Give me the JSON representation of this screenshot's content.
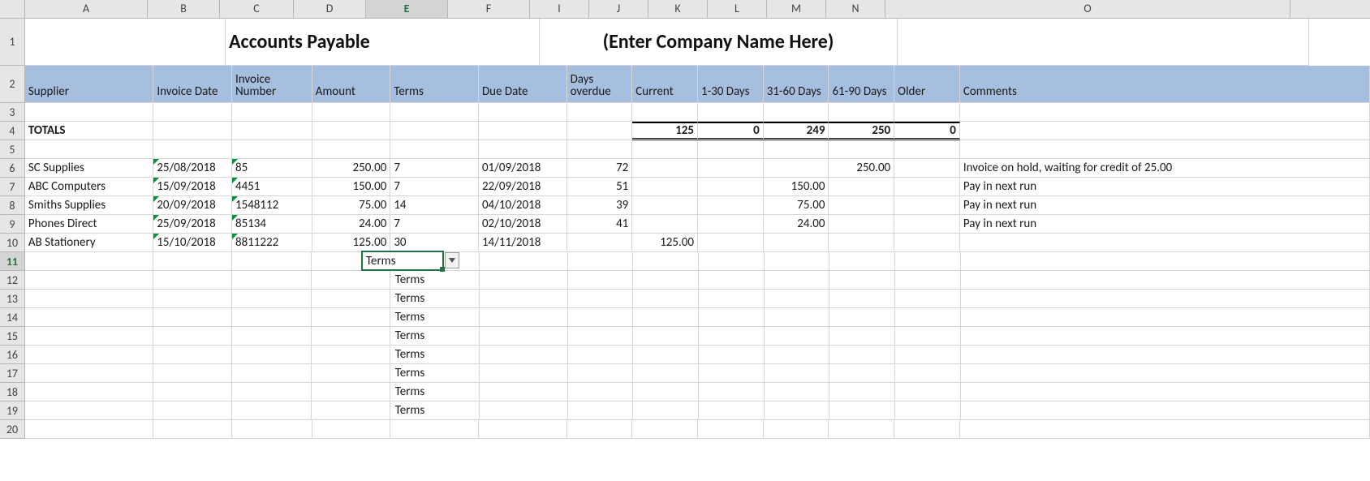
{
  "columns": [
    "A",
    "B",
    "C",
    "D",
    "E",
    "F",
    "I",
    "J",
    "K",
    "L",
    "M",
    "N",
    "O"
  ],
  "active_column": "E",
  "active_row": 11,
  "title_left": "Accounts Payable",
  "title_right": "(Enter Company Name Here)",
  "headers": {
    "A": "Supplier",
    "B": "Invoice Date",
    "C": "Invoice Number",
    "D": "Amount",
    "E": "Terms",
    "F": "Due Date",
    "I": "Days overdue",
    "J": "Current",
    "K": "1-30 Days",
    "L": "31-60 Days",
    "M": "61-90 Days",
    "N": "Older",
    "O": "Comments"
  },
  "totals_label": "TOTALS",
  "totals": {
    "J": "125",
    "K": "0",
    "L": "249",
    "M": "250",
    "N": "0"
  },
  "rows": [
    {
      "A": "SC Supplies",
      "B": "25/08/2018",
      "C": "85",
      "D": "250.00",
      "E": "7",
      "F": "01/09/2018",
      "I": "72",
      "J": "",
      "K": "",
      "L": "",
      "M": "250.00",
      "N": "",
      "O": "Invoice on hold, waiting for credit of 25.00"
    },
    {
      "A": "ABC Computers",
      "B": "15/09/2018",
      "C": "4451",
      "D": "150.00",
      "E": "7",
      "F": "22/09/2018",
      "I": "51",
      "J": "",
      "K": "",
      "L": "150.00",
      "M": "",
      "N": "",
      "O": "Pay in next run"
    },
    {
      "A": "Smiths Supplies",
      "B": "20/09/2018",
      "C": "1548112",
      "D": "75.00",
      "E": "14",
      "F": "04/10/2018",
      "I": "39",
      "J": "",
      "K": "",
      "L": "75.00",
      "M": "",
      "N": "",
      "O": "Pay in next run"
    },
    {
      "A": "Phones Direct",
      "B": "25/09/2018",
      "C": "85134",
      "D": "24.00",
      "E": "7",
      "F": "02/10/2018",
      "I": "41",
      "J": "",
      "K": "",
      "L": "24.00",
      "M": "",
      "N": "",
      "O": "Pay in next run"
    },
    {
      "A": "AB Stationery",
      "B": "15/10/2018",
      "C": "8811222",
      "D": "125.00",
      "E": "30",
      "F": "14/11/2018",
      "I": "",
      "J": "125.00",
      "K": "",
      "L": "",
      "M": "",
      "N": "",
      "O": ""
    }
  ],
  "terms_placeholder_rows": [
    11,
    12,
    13,
    14,
    15,
    16,
    17,
    18,
    19
  ],
  "terms_placeholder_text": "Terms",
  "last_blank_row": 20,
  "colors": {
    "header_band": "#a7bfde",
    "selection": "#217346"
  }
}
